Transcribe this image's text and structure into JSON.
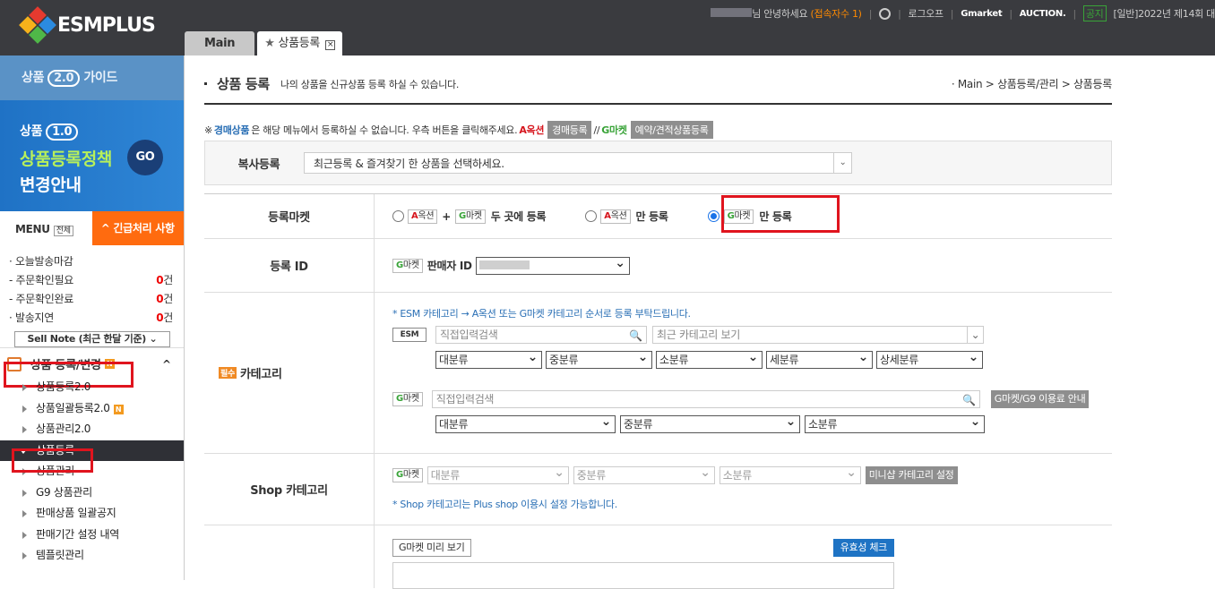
{
  "brand": {
    "name": "ESMPLUS"
  },
  "topbar": {
    "greeting": "님 안녕하세요",
    "visitors": "(접속자수 1)",
    "logout": "로그오프",
    "gmarket": "Gmarket",
    "auction": "AUCTION.",
    "notice_badge": "공지",
    "notice_text": "[일반]2022년 제14회 대"
  },
  "tabs": [
    {
      "label": "Main"
    },
    {
      "label": "상품등록",
      "close": "×"
    }
  ],
  "sidebar": {
    "guide": {
      "prefix": "상품",
      "version": "2.0",
      "suffix": "가이드"
    },
    "banner": {
      "prefix": "상품",
      "version": "1.0",
      "line2": "상품등록정책",
      "line3": "변경안내",
      "go": "GO"
    },
    "menu_label": "MENU",
    "menu_all": "전체",
    "urgent": "^ 긴급처리 사항",
    "status": [
      {
        "label": "· 오늘발송마감",
        "count": "",
        "unit": ""
      },
      {
        "label": "- 주문확인필요",
        "count": "0",
        "unit": "건"
      },
      {
        "label": "- 주문확인완료",
        "count": "0",
        "unit": "건"
      },
      {
        "label": "· 발송지연",
        "count": "0",
        "unit": "건"
      }
    ],
    "sellnote": "Sell Note (최근 한달 기준) ⌄",
    "section": {
      "title": "상품 등록/변경",
      "badge": "N",
      "toggle": "^"
    },
    "items": [
      {
        "label": "상품등록2.0"
      },
      {
        "label": "상품일괄등록2.0"
      },
      {
        "label": "상품관리2.0"
      },
      {
        "label": "상품등록"
      },
      {
        "label": "상품관리"
      },
      {
        "label": "G9 상품관리"
      },
      {
        "label": "판매상품 일괄공지"
      },
      {
        "label": "판매기간 설정 내역"
      },
      {
        "label": "템플릿관리"
      }
    ]
  },
  "page": {
    "title": "상품 등록",
    "subtitle": "나의 상품을 신규상품 등록 하실 수 있습니다.",
    "breadcrumb": "· Main > 상품등록/관리 > 상품등록"
  },
  "notice": {
    "prefix": "※",
    "bold": "경매상품",
    "text": "은 해당 메뉴에서 등록하실 수 없습니다. 우측 버튼을 클릭해주세요.",
    "auction_label": "A옥션",
    "auction_btn": "경매등록",
    "sep": "//",
    "gmarket_label": "G마켓",
    "gmarket_btn": "예약/견적상품등록"
  },
  "copy": {
    "label": "복사등록",
    "placeholder": "최근등록 & 즐겨찾기 한 상품을 선택하세요."
  },
  "market": {
    "label": "등록마켓",
    "opt1_plus": "+",
    "opt1_text": "두 곳에 등록",
    "opt2_text": "만 등록",
    "opt3_text": "만 등록",
    "auction": "옥션",
    "gmarket": "마켓"
  },
  "reg_id": {
    "label": "등록 ID",
    "seller": "판매자 ID"
  },
  "category": {
    "required": "필수",
    "label": "카테고리",
    "note": "* ESM 카테고리 → A옥션 또는 G마켓 카테고리 순서로 등록 부탁드립니다.",
    "esm": "ESM",
    "direct": "직접입력검색",
    "recent": "최근 카테고리 보기",
    "lv1": "대분류",
    "lv2": "중분류",
    "lv3": "소분류",
    "lv4": "세분류",
    "lv5": "상세분류",
    "g9_btn": "G마켓/G9 이용료 안내"
  },
  "shop": {
    "label": "Shop 카테고리",
    "mini_btn": "미니샵 카테고리 설정",
    "note": "* Shop 카테고리는 Plus shop 이용시 설정 가능합니다."
  },
  "preview": {
    "btn": "G마켓 미리 보기",
    "check": "유효성 체크"
  }
}
